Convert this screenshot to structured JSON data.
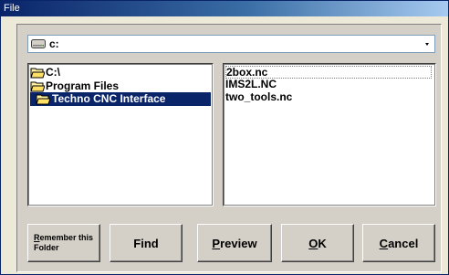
{
  "window": {
    "title": "File"
  },
  "drive": {
    "value": "c:"
  },
  "folders": [
    {
      "label": "C:\\",
      "selected": false,
      "depth": 0
    },
    {
      "label": "Program Files",
      "selected": false,
      "depth": 0
    },
    {
      "label": "Techno CNC Interface",
      "selected": true,
      "depth": 1
    }
  ],
  "files": [
    {
      "name": "2box.nc",
      "focused": true
    },
    {
      "name": "IMS2L.NC",
      "focused": false
    },
    {
      "name": "two_tools.nc",
      "focused": false
    }
  ],
  "buttons": {
    "remember_first": "R",
    "remember_rest": "emember this",
    "remember_line2": "Folder",
    "find": "Find",
    "preview_first": "P",
    "preview_rest": "review",
    "ok_first": "O",
    "ok_rest": "K",
    "cancel_first": "C",
    "cancel_rest": "ancel"
  },
  "colors": {
    "title_bar": "#0a246a",
    "selection": "#0a246a",
    "dialog": "#d4d0c8"
  }
}
